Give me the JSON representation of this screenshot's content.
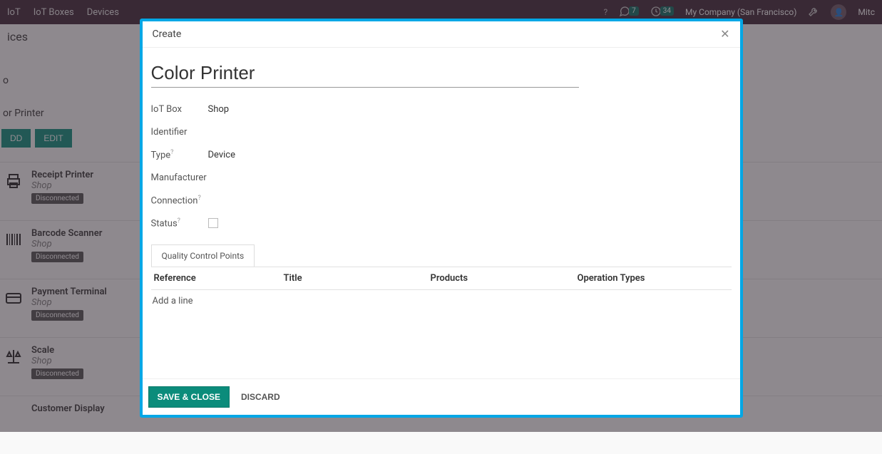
{
  "nav": {
    "app": "IoT",
    "menu": [
      "IoT Boxes",
      "Devices"
    ],
    "msg_count": "7",
    "activity_count": "34",
    "company": "My Company (San Francisco)",
    "user": "Mitc"
  },
  "bg": {
    "header": "ices",
    "sub_part": "o",
    "current": "or Printer",
    "btn_add": "DD",
    "btn_edit": "EDIT",
    "cards": [
      {
        "title": "Receipt Printer",
        "shop": "Shop",
        "tag": "Disconnected",
        "icon": "printer"
      },
      {
        "title": "Barcode Scanner",
        "shop": "Shop",
        "tag": "Disconnected",
        "icon": "barcode"
      },
      {
        "title": "Payment Terminal",
        "shop": "Shop",
        "tag": "Disconnected",
        "icon": "card"
      },
      {
        "title": "Scale",
        "shop": "Shop",
        "tag": "Disconnected",
        "icon": "scale"
      },
      {
        "title": "Customer Display",
        "shop": "",
        "tag": "",
        "icon": ""
      }
    ]
  },
  "modal": {
    "title": "Create",
    "name_value": "Color Printer",
    "fields": {
      "iot_box_label": "IoT Box",
      "iot_box_value": "Shop",
      "identifier_label": "Identifier",
      "identifier_value": "",
      "type_label": "Type",
      "type_value": "Device",
      "manufacturer_label": "Manufacturer",
      "manufacturer_value": "",
      "connection_label": "Connection",
      "connection_value": "",
      "status_label": "Status",
      "status_value": ""
    },
    "tab": "Quality Control Points",
    "columns": {
      "c1": "Reference",
      "c2": "Title",
      "c3": "Products",
      "c4": "Operation Types"
    },
    "add_line": "Add a line",
    "save": "SAVE & CLOSE",
    "discard": "DISCARD"
  }
}
